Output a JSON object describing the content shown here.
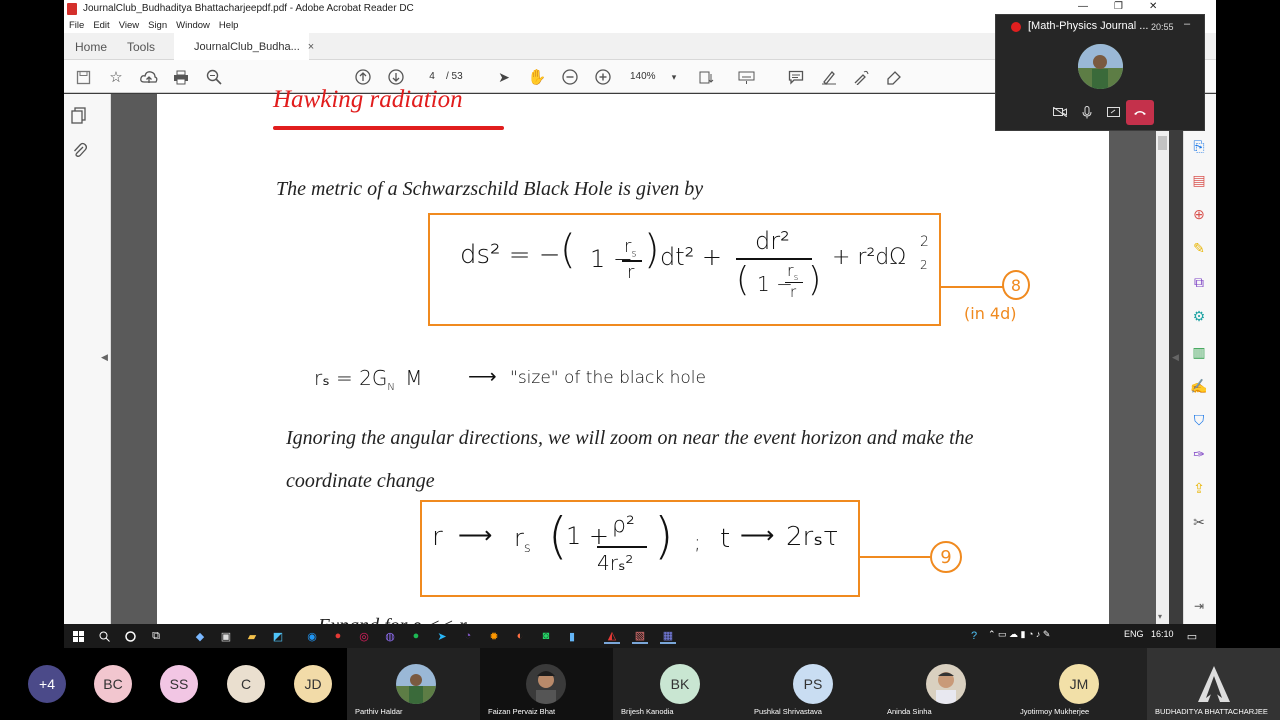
{
  "window": {
    "title": "JournalClub_Budhaditya Bhattacharjeepdf.pdf - Adobe Acrobat Reader DC",
    "controls": {
      "minimize": "—",
      "restore": "❐",
      "close": "✕"
    }
  },
  "menu": [
    "File",
    "Edit",
    "View",
    "Sign",
    "Window",
    "Help"
  ],
  "tabs": {
    "home": "Home",
    "tools": "Tools",
    "doc": "JournalClub_Budha...",
    "close": "×"
  },
  "toolbar": {
    "page_current": "4",
    "page_total": "/ 53",
    "zoom": "140%"
  },
  "document": {
    "heading": "Hawking radiation",
    "line1": "The metric of a Schwarzschild Black Hole is given by",
    "eq8": {
      "ds2": "ds² = −",
      "term1": "(1 − r",
      "term1_sub": "s",
      "term1_den": "r",
      "term1_rest": ")dt²  +",
      "frac_num": "dr²",
      "frac_den": "(1 − r",
      "frac_den_sub": "s",
      "frac_den_r": "r",
      "tail": "+ r²dΩ",
      "tail_sup": "2",
      "tail_sub": "2",
      "label": "8",
      "note": "(in 4d)"
    },
    "rs_line": {
      "lhs": "rₛ = 2G",
      "sub": "N",
      "mass": "M",
      "arrow": "⟶",
      "desc": "\"size\" of the black hole"
    },
    "line2": "Ignoring the angular directions, we will zoom on near the event horizon and make the",
    "line3": "coordinate change",
    "eq9": {
      "r": "r",
      "arrow1": "⟶",
      "rs": "r",
      "rs_sub": "s",
      "paren_open": "(",
      "one_plus": "1 +",
      "rho_num": "ρ²",
      "rho_den": "4rₛ²",
      "paren_close": ")",
      "sep": ";",
      "t": "t",
      "arrow2": "⟶",
      "rhs": "2rₛτ",
      "label": "9"
    },
    "cut_line": "Expand for ρ << r"
  },
  "teams": {
    "title": "[Math-Physics Journal ...",
    "time": "20:55",
    "minimize": "–"
  },
  "taskbar": {
    "lang": "ENG",
    "time": "16:10"
  },
  "participants": {
    "overflow": "+4",
    "circles": [
      {
        "initials": "BC",
        "color": "#f2c6cf"
      },
      {
        "initials": "SS",
        "color": "#f2c6e4"
      },
      {
        "initials": "C",
        "color": "#eadfcf"
      },
      {
        "initials": "JD",
        "color": "#f2dba8"
      }
    ],
    "tiles": [
      {
        "name": "Parthiv Haldar",
        "kind": "photo"
      },
      {
        "name": "Faizan Pervaiz Bhat",
        "kind": "photo"
      },
      {
        "name": "Brijesh Kanodia",
        "kind": "initials",
        "initials": "BK",
        "color": "#c9e6d2"
      },
      {
        "name": "Pushkal Shrivastava",
        "kind": "initials",
        "initials": "PS",
        "color": "#c9ddf2"
      },
      {
        "name": "Aninda Sinha",
        "kind": "photo"
      },
      {
        "name": "Jyotirmoy Mukherjee",
        "kind": "initials",
        "initials": "JM",
        "color": "#f2e0a8"
      },
      {
        "name": "BUDHADITYA BHATTACHARJEE",
        "kind": "logo"
      }
    ]
  }
}
